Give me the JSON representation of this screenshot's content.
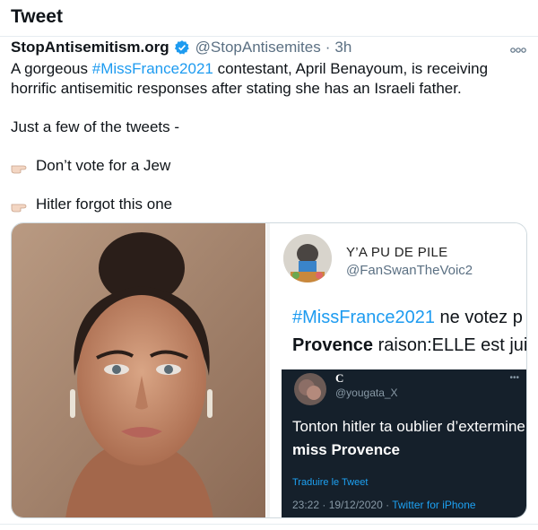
{
  "header": {
    "title": "Tweet"
  },
  "tweet": {
    "author_name": "StopAntisemitism.org",
    "handle": "@StopAntisemites",
    "separator": "·",
    "time": "3h",
    "more_icon": "more-horizontal-icon",
    "body": {
      "line1_pre": "A gorgeous ",
      "line1_hashtag": "#MissFrance2021",
      "line1_post": " contestant, April Benayoum, is receiving",
      "line2": "horrific antisemitic responses after stating she has an Israeli father.",
      "line3": "Just a few of the tweets  -",
      "quote1": "Don’t vote for a Jew",
      "quote2": "Hitler forgot this one"
    }
  },
  "embedded_screenshot": {
    "name": "Y’A PU DE PILE",
    "handle": "@FanSwanTheVoic2",
    "text1_hashtag": "#MissFrance2021",
    "text1_post": " ne votez p",
    "text2_bold": "Provence",
    "text2_post": " raison:ELLE est jui",
    "reply": {
      "name": "C",
      "handle": "@yougata_X",
      "text1": "Tonton hitler ta oublier d’exterminer",
      "text2": "miss Provence",
      "translate": "Traduire le Tweet",
      "meta_time": "23:22 · 19/12/2020 · ",
      "meta_source": "Twitter for iPhone"
    }
  },
  "colors": {
    "link": "#1d9bf0",
    "secondary": "#5b7083",
    "dark_bg": "#15202b"
  }
}
